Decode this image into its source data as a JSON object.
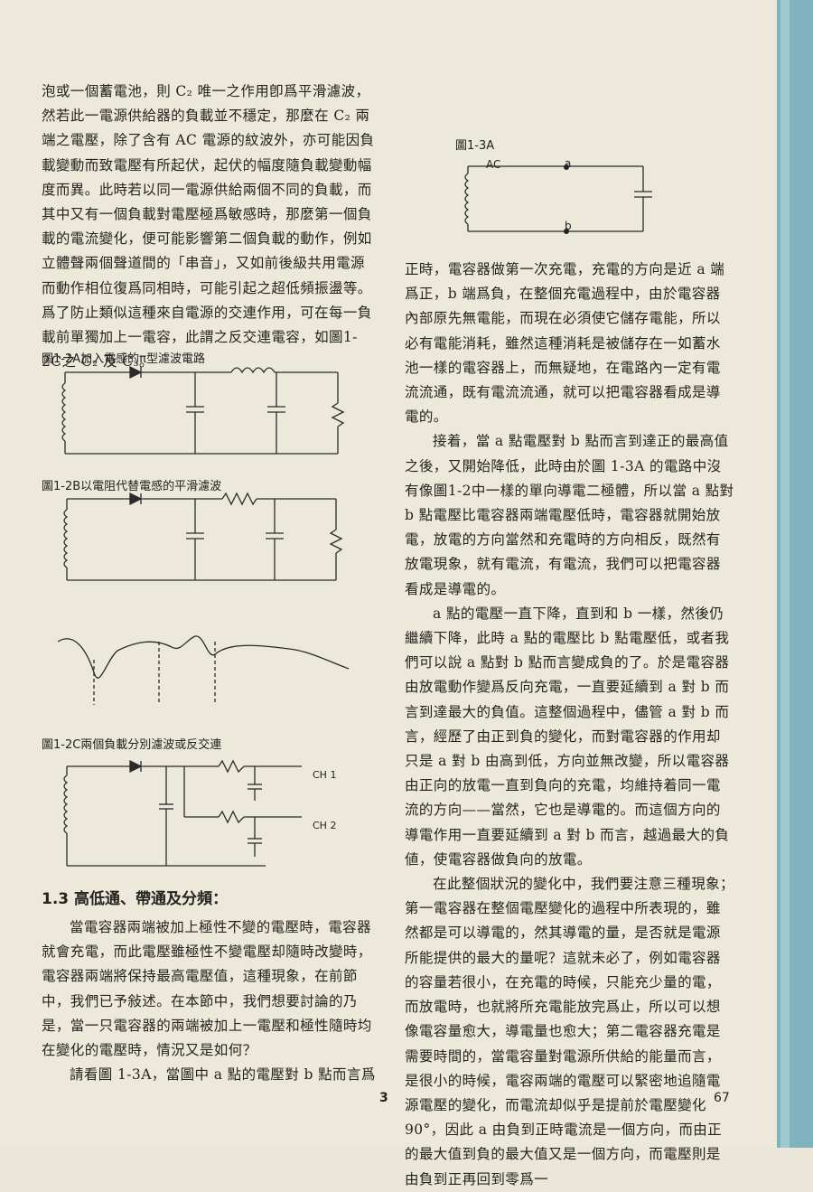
{
  "left_top_text": "泡或一個蓄電池，則 C₂ 唯一之作用卽爲平滑濾波，然若此一電源供給器的負載並不穩定，那麼在 C₂ 兩端之電壓，除了含有 AC 電源的紋波外，亦可能因負載變動而致電壓有所起伏，起伏的幅度隨負載變動幅度而異。此時若以同一電源供給兩個不同的負載，而其中又有一個負載對電壓極爲敏感時，那麼第一個負載的電流變化，便可能影響第二個負載的動作，例如立體聲兩個聲道間的「串音」，又如前後級共用電源而動作相位復爲同相時，可能引起之超低頻振盪等。爲了防止類似這種來自電源的交連作用，可在每一負載前單獨加上一電容，此謂之反交連電容，如圖1-2C之 C₂ 及 C₃。",
  "fig_2a_caption": "圖1-2A加入電感的π型濾波電路",
  "fig_2b_caption": "圖1-2B以電阻代替電感的平滑濾波",
  "fig_2c_caption": "圖1-2C兩個負載分別濾波或反交連",
  "fig_2c_ch1": "CH 1",
  "fig_2c_ch2": "CH 2",
  "fig_3a_caption": "圖1-3A",
  "fig_3a_ac": "AC",
  "fig_3a_a": "a",
  "fig_3a_b": "b",
  "section_heading": "1.3 高低通、帶通及分頻：",
  "left_bottom_text": "當電容器兩端被加上極性不變的電壓時，電容器就會充電，而此電壓雖極性不變電壓却隨時改變時，電容器兩端將保持最高電壓值，這種現象，在前節中，我們已予敍述。在本節中，我們想要討論的乃是，當一只電容器的兩端被加上一電壓和極性隨時均在變化的電壓時，情況又是如何？",
  "left_bottom_text2": "請看圖 1-3A，當圖中 a 點的電壓對 b 點而言爲",
  "right_p1": "正時，電容器做第一次充電，充電的方向是近 a 端爲正，b 端爲負，在整個充電過程中，由於電容器內部原先無電能，而現在必須使它儲存電能，所以必有電能消耗，雖然這種消耗是被儲存在一如蓄水池一樣的電容器上，而無疑地，在電路內一定有電流流通，既有電流流通，就可以把電容器看成是導電的。",
  "right_p2": "接着，當 a 點電壓對 b 點而言到達正的最高值之後，又開始降低，此時由於圖 1-3A 的電路中沒有像圖1-2中一樣的單向導電二極體，所以當 a 點對 b 點電壓比電容器兩端電壓低時，電容器就開始放電，放電的方向當然和充電時的方向相反，既然有放電現象，就有電流，有電流，我們可以把電容器看成是導電的。",
  "right_p3": "a 點的電壓一直下降，直到和 b 一樣，然後仍繼續下降，此時 a 點的電壓比 b 點電壓低，或者我們可以說 a 點對 b 點而言變成負的了。於是電容器由放電動作變爲反向充電，一直要延續到 a 對 b 而言到達最大的負值。這整個過程中，儘管 a 對 b 而言，經歷了由正到負的變化，而對電容器的作用却只是 a 對 b 由高到低，方向並無改變，所以電容器由正向的放電一直到負向的充電，均維持着同一電流的方向——當然，它也是導電的。而這個方向的導電作用一直要延續到 a 對 b 而言，越過最大的負値，使電容器做負向的放電。",
  "right_p4": "在此整個狀況的變化中，我們要注意三種現象；第一電容器在整個電壓變化的過程中所表現的，雖然都是可以導電的，然其導電的量，是否就是電源所能提供的最大的量呢？這就未必了，例如電容器的容量若很小，在充電的時候，只能充少量的電，而放電時，也就將所充電能放完爲止，所以可以想像電容量愈大，導電量也愈大；第二電容器充電是需要時間的，當電容量對電源所供給的能量而言，是很小的時候，電容兩端的電壓可以緊密地追隨電源電壓的變化，而電流却似乎是提前於電壓變化90°，因此 a 由負到正時電流是一個方向，而由正的最大值到負的最大值又是一個方向，而電壓則是由負到正再回到零爲一",
  "folio_left": "3",
  "folio_right": "67"
}
